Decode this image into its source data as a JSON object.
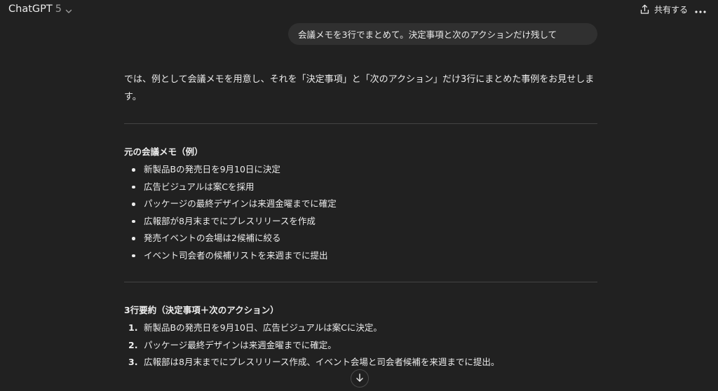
{
  "header": {
    "model_name": "ChatGPT",
    "model_version": "5",
    "share_label": "共有する",
    "icons": {
      "model_dropdown": "chevron-down-icon",
      "share": "share-upload-icon",
      "more": "more-horizontal-icon",
      "scroll": "arrow-down-icon"
    }
  },
  "user_message": {
    "text": "会議メモを3行でまとめて。決定事項と次のアクションだけ残して"
  },
  "assistant": {
    "intro": "では、例として会議メモを用意し、それを「決定事項」と「次のアクション」だけ3行にまとめた事例をお見せします。",
    "memo_title": "元の会議メモ（例）",
    "memo_items": [
      "新製品Bの発売日を9月10日に決定",
      "広告ビジュアルは案Cを採用",
      "パッケージの最終デザインは来週金曜までに確定",
      "広報部が8月末までにプレスリリースを作成",
      "発売イベントの会場は2候補に絞る",
      "イベント司会者の候補リストを来週までに提出"
    ],
    "summary_title": "3行要約（決定事項＋次のアクション）",
    "summary_items": [
      {
        "num": "1.",
        "text": "新製品Bの発売日を9月10日、広告ビジュアルは案Cに決定。"
      },
      {
        "num": "2.",
        "text": "パッケージ最終デザインは来週金曜までに確定。"
      },
      {
        "num": "3.",
        "text": "広報部は8月末までにプレスリリース作成、イベント会場と司会者候補を来週までに提出。"
      }
    ]
  },
  "colors": {
    "background": "#212121",
    "bubble": "#303030",
    "text": "#ececec",
    "muted": "#9b9b9b",
    "divider": "#444444"
  }
}
